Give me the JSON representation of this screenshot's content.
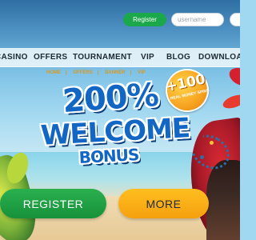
{
  "topbar": {
    "register_label": "Register",
    "username_placeholder": "username"
  },
  "nav": {
    "items": [
      {
        "label": "CASINO"
      },
      {
        "label": "OFFERS"
      },
      {
        "label": "TOURNAMENT"
      },
      {
        "label": "VIP"
      },
      {
        "label": "BLOG"
      },
      {
        "label": "DOWNLOAD"
      }
    ]
  },
  "breadcrumb": {
    "items": [
      "HOME",
      "OFFERS",
      "BANNER",
      "VIP"
    ]
  },
  "promo": {
    "headline_line1": "200%",
    "headline_line2": "WELCOME",
    "headline_line3": "BONUS",
    "badge_value": "+100",
    "badge_text": "REAL MONEY SPINS"
  },
  "cta": {
    "register_label": "REGISTER",
    "more_label": "MORE"
  },
  "colors": {
    "register_green": "#1ba84a",
    "more_orange": "#f7a814",
    "headline_blue": "#1267c4",
    "breadcrumb_orange": "#d79a26"
  }
}
